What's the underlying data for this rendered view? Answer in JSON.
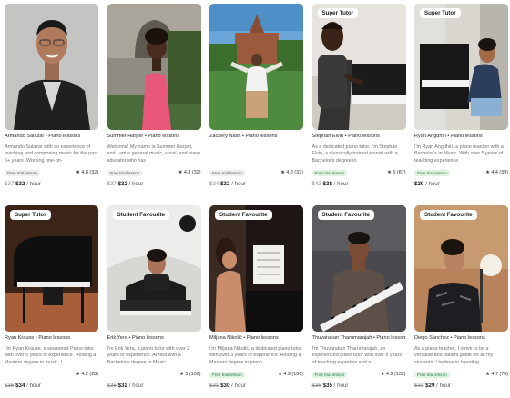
{
  "tutors": [
    {
      "name": "Armando Salazar • Piano lessons",
      "description": "Armando Salazar with an experience of teaching and composing music for the past 5+ years. Working one-on-",
      "badge": "",
      "trial": "Free trial lesson",
      "trial_style": "grey",
      "rating": "★ 4.8 (32)",
      "old_price": "$37",
      "price": "$32",
      "unit": "/ hour"
    },
    {
      "name": "Summer Harper • Piano lessons",
      "description": "Welcome! My name is Summer Harper, and I am a general music, vocal, and piano educator who has",
      "badge": "",
      "trial": "Free trial lesson",
      "trial_style": "grey",
      "rating": "★ 4.8 (32)",
      "old_price": "$37",
      "price": "$32",
      "unit": "/ hour"
    },
    {
      "name": "Zackery Nash • Piano lessons",
      "description": "",
      "badge": "",
      "trial": "Free trial lesson",
      "trial_style": "grey",
      "rating": "★ 4.8 (32)",
      "old_price": "$34",
      "price": "$32",
      "unit": "/ hour"
    },
    {
      "name": "Stephan Elvin • Piano lessons",
      "description": "As a dedicated piano tutor, I'm Stephan Elvin, a classically trained pianist with a Bachelor's degree in",
      "badge": "Super Tutor",
      "trial": "Free trial lesson",
      "trial_style": "green",
      "rating": "★ 5 (87)",
      "old_price": "$43",
      "price": "$38",
      "unit": "/ hour"
    },
    {
      "name": "Ryan Angdhiri • Piano lessons",
      "description": "I'm Ryan Angdhiri, a piano teacher with a Bachelor's in Music. With over 5 years of teaching experience",
      "badge": "Super Tutor",
      "trial": "Free trial lesson",
      "trial_style": "green",
      "rating": "★ 4.4 (39)",
      "old_price": "",
      "price": "$29",
      "unit": "/ hour"
    },
    {
      "name": "Ryan Krause • Piano lessons",
      "description": "I'm Ryan Krause, a seasoned Piano tutor with over 5 years of experience. Holding a Masters degree in music, I",
      "badge": "Super Tutor",
      "trial": "",
      "trial_style": "grey",
      "rating": "★ 4.2 (28)",
      "old_price": "$36",
      "price": "$34",
      "unit": "/ hour"
    },
    {
      "name": "Erik Yera • Piano lessons",
      "description": "I'm Erik Yera, a piano tutor with over 2 years of experience. Armed with a Bachelor's degree in Music",
      "badge": "Student Favourite",
      "trial": "",
      "trial_style": "grey",
      "rating": "★ 5 (109)",
      "old_price": "$35",
      "price": "$32",
      "unit": "/ hour"
    },
    {
      "name": "Miljana Nikolić • Piano lessons",
      "description": "I'm Miljana Nikolić, a dedicated piano tutor with over 3 years of experience. Holding a Masters degree in piano,",
      "badge": "Student Favourite",
      "trial": "Free trial lesson",
      "trial_style": "green",
      "rating": "★ 4.9 (106)",
      "old_price": "$31",
      "price": "$30",
      "unit": "/ hour"
    },
    {
      "name": "Thuvarakan Tharumarajah • Piano lessons",
      "description": "I'm Thuvarakan Tharumarajah, an experienced piano tutor with over 8 years of teaching expertise and a",
      "badge": "Student Favourite",
      "trial": "Free trial lesson",
      "trial_style": "green",
      "rating": "★ 4.9 (132)",
      "old_price": "$36",
      "price": "$35",
      "unit": "/ hour"
    },
    {
      "name": "Diego Sanchez • Piano lessons",
      "description": "As a piano teacher, I strive to be a versatile and patient guide for all my students. I believe in blending...",
      "badge": "Student Favourite",
      "trial": "Free trial lesson",
      "trial_style": "green",
      "rating": "★ 4.7 (70)",
      "old_price": "$31",
      "price": "$29",
      "unit": "/ hour"
    }
  ]
}
